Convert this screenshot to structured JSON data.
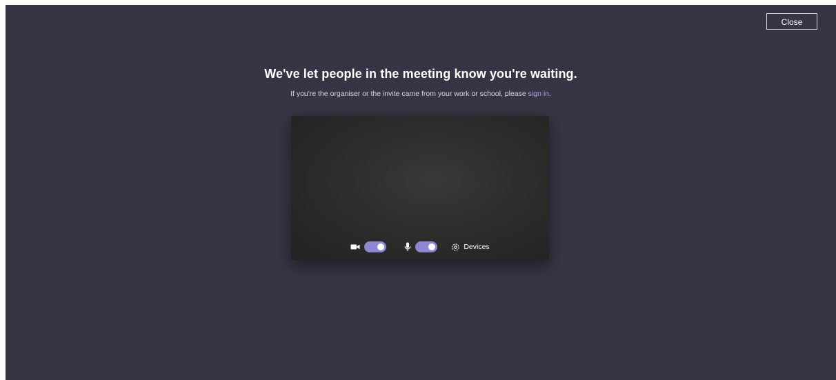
{
  "close_button": {
    "label": "Close"
  },
  "heading": "We've let people in the meeting know you're waiting.",
  "subtext": {
    "before_link": "If you're the organiser or the invite came from your work or school, please ",
    "link": "sign in",
    "after_link": "."
  },
  "preview": {
    "camera": {
      "icon": "camera-icon",
      "enabled": true
    },
    "microphone": {
      "icon": "microphone-icon",
      "enabled": true
    },
    "devices": {
      "icon": "gear-icon",
      "label": "Devices"
    }
  },
  "colors": {
    "background": "#373545",
    "toggle_on": "#8b87d3",
    "link": "#a9a6e6"
  }
}
